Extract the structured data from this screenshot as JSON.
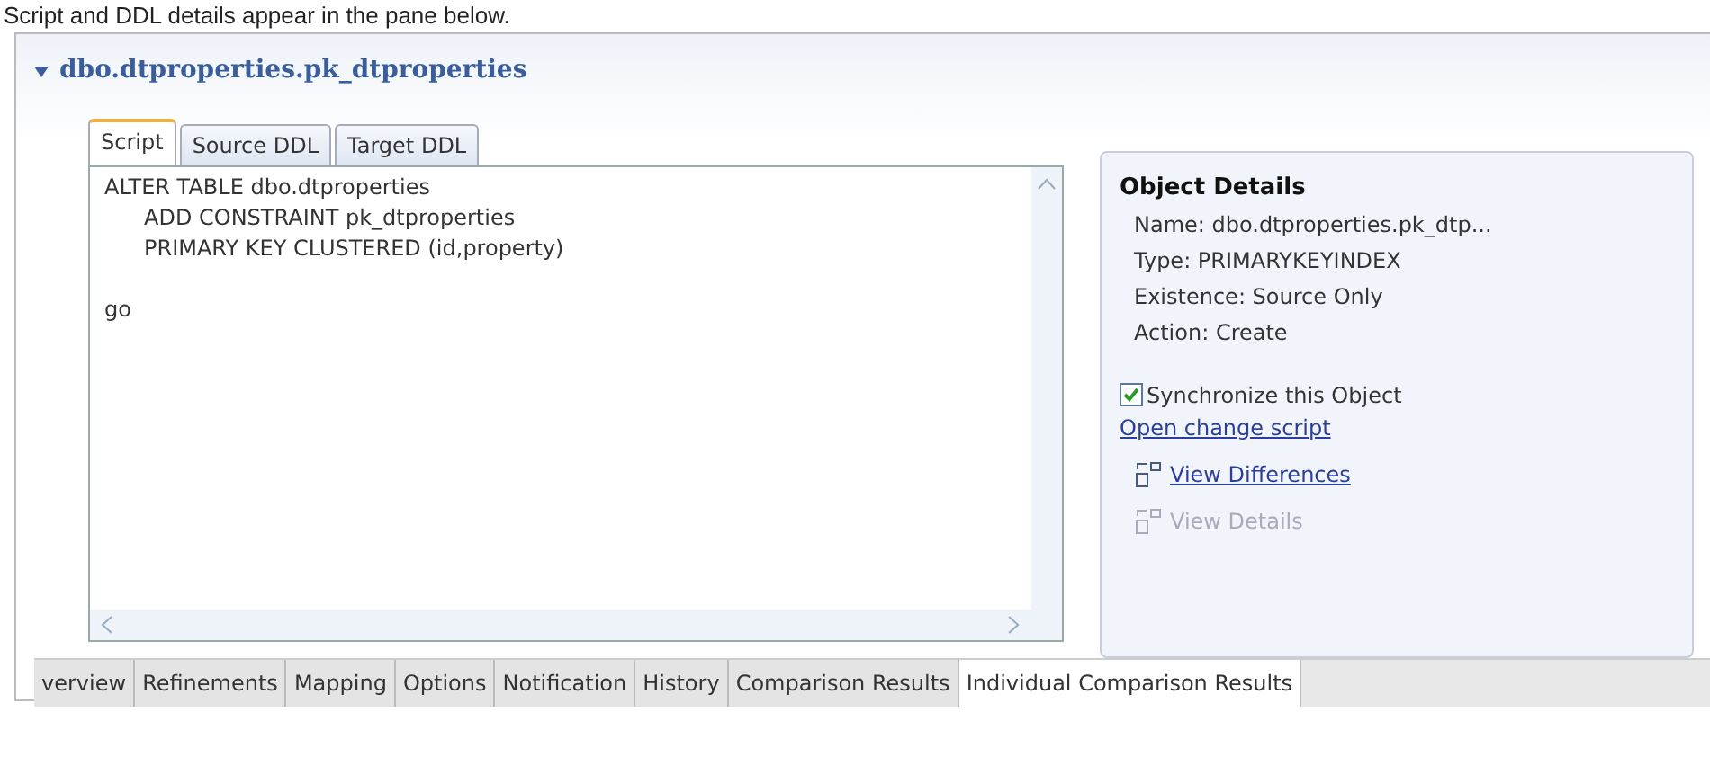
{
  "caption": "Script and DDL details appear in the pane below.",
  "section": {
    "title": "dbo.dtproperties.pk_dtproperties",
    "expanded": true
  },
  "script_tabs": [
    {
      "label": "Script",
      "selected": true
    },
    {
      "label": "Source DDL",
      "selected": false
    },
    {
      "label": "Target DDL",
      "selected": false
    }
  ],
  "script_lines": [
    {
      "text": "ALTER TABLE dbo.dtproperties",
      "children": [
        {
          "text": "ADD CONSTRAINT pk_dtproperties"
        },
        {
          "text": "PRIMARY KEY CLUSTERED (id,property)"
        }
      ]
    },
    {
      "text": "go"
    }
  ],
  "object_details": {
    "title": "Object Details",
    "fields": [
      "Name: dbo.dtproperties.pk_dtp...",
      "Type: PRIMARYKEYINDEX",
      "Existence: Source Only",
      "Action: Create"
    ],
    "synchronize": {
      "label": "Synchronize this Object",
      "checked": true
    },
    "open_change_script": "Open change script",
    "actions": [
      {
        "label": "View Differences",
        "disabled": false
      },
      {
        "label": "View Details",
        "disabled": true
      }
    ]
  },
  "bottom_tabs": [
    {
      "label": "verview",
      "selected": false
    },
    {
      "label": "Refinements",
      "selected": false
    },
    {
      "label": "Mapping",
      "selected": false
    },
    {
      "label": "Options",
      "selected": false
    },
    {
      "label": "Notification",
      "selected": false
    },
    {
      "label": "History",
      "selected": false
    },
    {
      "label": "Comparison Results",
      "selected": false
    },
    {
      "label": "Individual Comparison Results",
      "selected": true
    }
  ]
}
